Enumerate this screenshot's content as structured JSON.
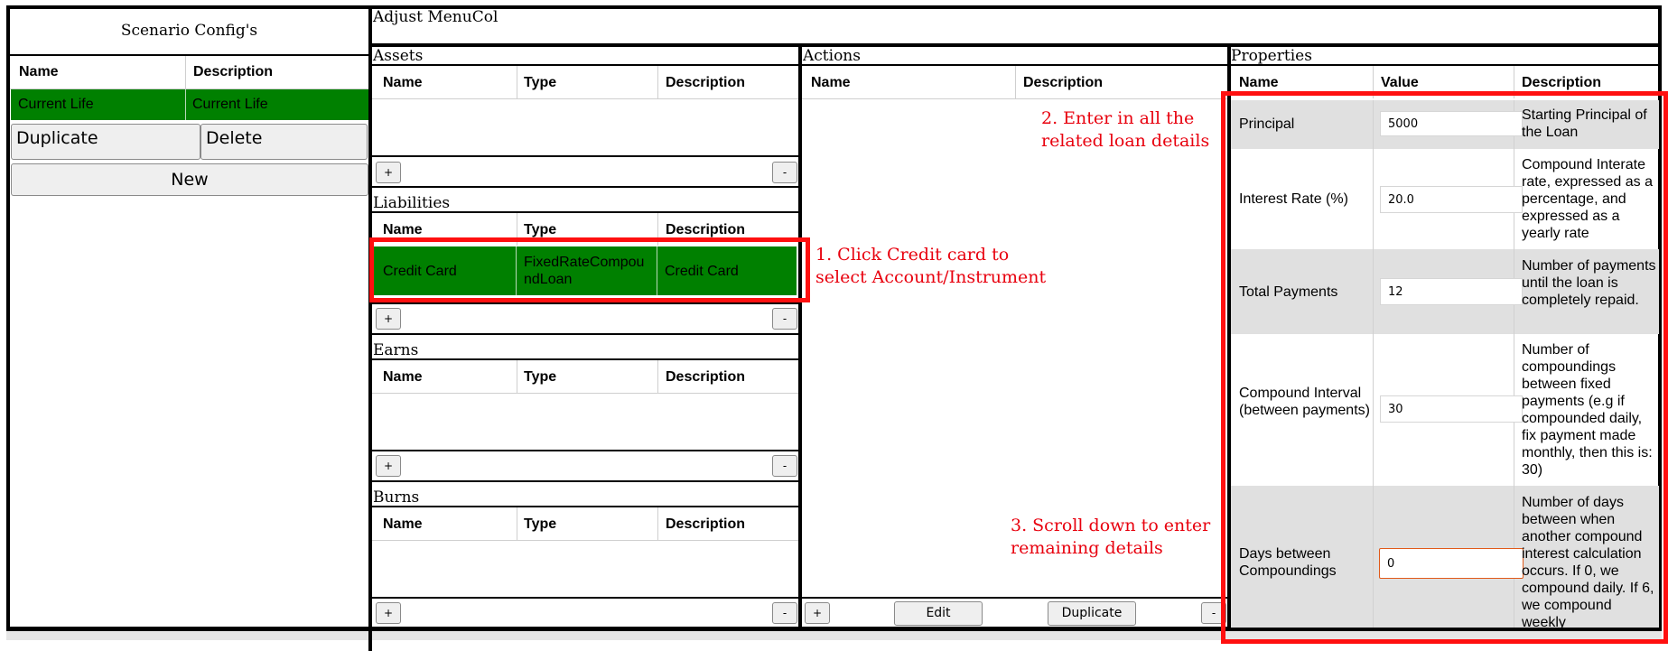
{
  "left": {
    "title": "Scenario Config's",
    "col_name": "Name",
    "col_desc": "Description",
    "row": {
      "name": "Current Life",
      "description": "Current Life"
    },
    "duplicate": "Duplicate",
    "delete": "Delete",
    "new": "New"
  },
  "menu_title": "Adjust MenuCol",
  "assets": {
    "title": "Assets",
    "col_name": "Name",
    "col_type": "Type",
    "col_desc": "Description",
    "plus": "+",
    "minus": "-"
  },
  "liabilities": {
    "title": "Liabilities",
    "col_name": "Name",
    "col_type": "Type",
    "col_desc": "Description",
    "row": {
      "name": "Credit Card",
      "type": "FixedRateCompoundLoan",
      "description": "Credit Card"
    },
    "plus": "+",
    "minus": "-"
  },
  "earns": {
    "title": "Earns",
    "col_name": "Name",
    "col_type": "Type",
    "col_desc": "Description",
    "plus": "+",
    "minus": "-"
  },
  "burns": {
    "title": "Burns",
    "col_name": "Name",
    "col_type": "Type",
    "col_desc": "Description",
    "plus": "+",
    "minus": "-"
  },
  "actions": {
    "title": "Actions",
    "col_name": "Name",
    "col_desc": "Description",
    "plus": "+",
    "edit": "Edit",
    "duplicate": "Duplicate",
    "minus": "-"
  },
  "properties": {
    "title": "Properties",
    "col_name": "Name",
    "col_value": "Value",
    "col_desc": "Description",
    "rows": [
      {
        "name": "Principal",
        "value": "5000",
        "description": "Starting Principal of the Loan"
      },
      {
        "name": "Interest Rate (%)",
        "value": "20.0",
        "description": "Compound Interate rate, expressed as a percentage, and expressed as a yearly rate"
      },
      {
        "name": "Total Payments",
        "value": "12",
        "description": "Number of payments until the loan is completely repaid."
      },
      {
        "name": "Compound Interval (between payments)",
        "value": "30",
        "description": "Number of compoundings between fixed payments (e.g if compounded daily, fix payment made monthly, then this is: 30)"
      },
      {
        "name": "Days between Compoundings",
        "value": "0",
        "description": "Number of days between when another compound interest calculation occurs. If 0, we compound daily. If 6, we compound weekly"
      }
    ]
  },
  "annotations": {
    "step1_line1": "1. Click Credit card to",
    "step1_line2": "select Account/Instrument",
    "step2_line1": "2. Enter in all the",
    "step2_line2": "related loan details",
    "step3_line1": "3. Scroll down to enter",
    "step3_line2": "remaining details"
  },
  "colors": {
    "selected_row": "#008000",
    "annotation": "#e8000e",
    "property_band": "#e0e0e0"
  }
}
